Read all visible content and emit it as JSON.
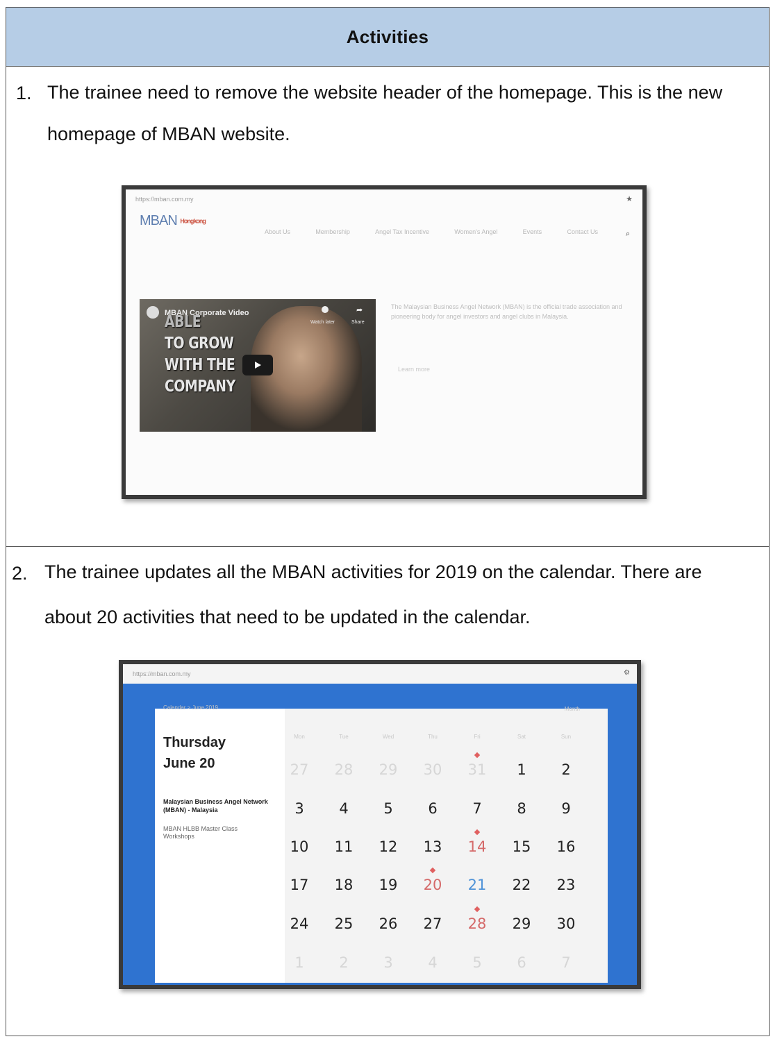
{
  "title": "Activities",
  "items": [
    {
      "number": "1.",
      "line1": "The trainee need to remove the website header of the homepage. This is the new",
      "line2": "homepage of MBAN website."
    },
    {
      "number": "2.",
      "line1": "The trainee updates all the MBAN activities for 2019 on the calendar. There are",
      "line2": "about 20 activities that need to be updated in the calendar."
    }
  ],
  "shot1": {
    "url": "https://mban.com.my",
    "logo": "MBAN",
    "logo_partner": "Hongkong",
    "nav": [
      "About Us",
      "Membership",
      "Angel Tax Incentive",
      "Women's Angel",
      "Events",
      "Contact Us"
    ],
    "video_title": "MBAN Corporate Video",
    "video_actions": [
      "Watch later",
      "Share"
    ],
    "video_caption": [
      "ABLE",
      "TO GROW",
      "WITH THE",
      "COMPANY"
    ],
    "intro": "The Malaysian Business Angel Network (MBAN) is the official trade association and pioneering body for angel investors and angel clubs in Malaysia.",
    "button": "Learn more"
  },
  "shot2": {
    "url": "https://mban.com.my",
    "breadcrumb": "Calendar > June 2019",
    "view": "Month",
    "weekday": "Thursday",
    "date": "June 20",
    "event_org": "Malaysian Business Angel Network (MBAN) - Malaysia",
    "event_name": "MBAN HLBB Master Class Workshops",
    "weekdays": [
      "Mon",
      "Tue",
      "Wed",
      "Thu",
      "Fri",
      "Sat",
      "Sun"
    ],
    "weeks": [
      [
        "27",
        "28",
        "29",
        "30",
        "31",
        "1",
        "2"
      ],
      [
        "3",
        "4",
        "5",
        "6",
        "7",
        "8",
        "9"
      ],
      [
        "10",
        "11",
        "12",
        "13",
        "14",
        "15",
        "16"
      ],
      [
        "17",
        "18",
        "19",
        "20",
        "21",
        "22",
        "23"
      ],
      [
        "24",
        "25",
        "26",
        "27",
        "28",
        "29",
        "30"
      ],
      [
        "1",
        "2",
        "3",
        "4",
        "5",
        "6",
        "7"
      ]
    ]
  }
}
